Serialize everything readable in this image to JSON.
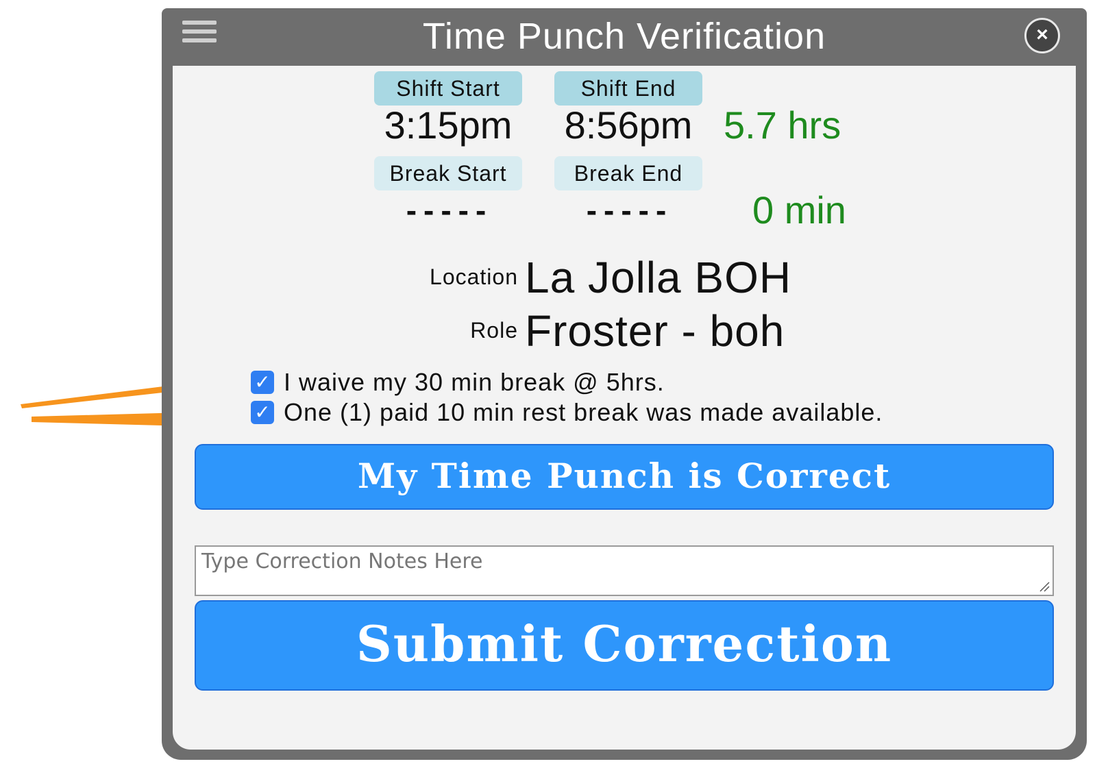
{
  "window": {
    "title": "Time Punch Verification"
  },
  "shift": {
    "start_label": "Shift Start",
    "start_value": "3:15pm",
    "end_label": "Shift End",
    "end_value": "8:56pm",
    "total": "5.7 hrs"
  },
  "break": {
    "start_label": "Break Start",
    "start_value": "-----",
    "end_label": "Break End",
    "end_value": "-----",
    "total": "0 min"
  },
  "details": {
    "location_label": "Location",
    "location_value": "La Jolla BOH",
    "role_label": "Role",
    "role_value": "Froster - boh"
  },
  "checkboxes": [
    {
      "label": "I waive my 30 min break @ 5hrs.",
      "checked": true
    },
    {
      "label": "One (1) paid 10 min rest break was made available.",
      "checked": true
    }
  ],
  "actions": {
    "confirm_label": "My Time Punch is Correct",
    "notes_placeholder": "Type Correction Notes Here",
    "submit_label": "Submit Correction"
  },
  "colors": {
    "titlebar": "#6e6e6e",
    "button": "#2e96fb",
    "checkbox": "#2f7ef2",
    "total_text": "#1e8b1e",
    "pill": "#a9d8e3",
    "arrow": "#f7941d"
  }
}
